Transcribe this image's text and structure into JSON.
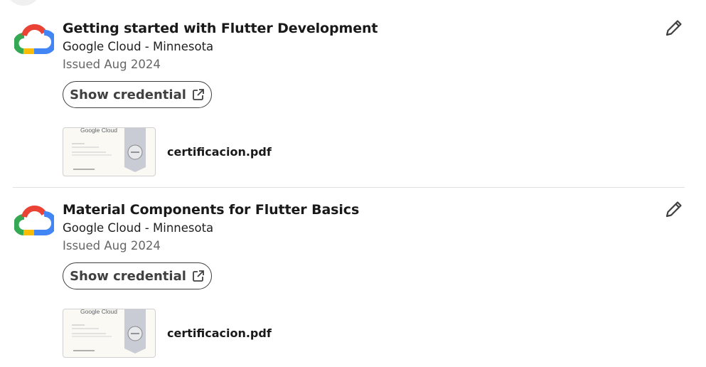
{
  "certifications": [
    {
      "title": "Getting started with Flutter Development",
      "issuer": "Google Cloud - Minnesota",
      "issued": "Issued Aug 2024",
      "show_credential_label": "Show credential",
      "media": {
        "thumbnail_logo_text": "Google Cloud",
        "file_name": "certificacion.pdf"
      }
    },
    {
      "title": "Material Components for Flutter Basics",
      "issuer": "Google Cloud - Minnesota",
      "issued": "Issued Aug 2024",
      "show_credential_label": "Show credential",
      "media": {
        "thumbnail_logo_text": "Google Cloud",
        "file_name": "certificacion.pdf"
      }
    }
  ],
  "icons": {
    "issuer_logo": "google-cloud-logo-icon",
    "external_link": "external-link-icon",
    "edit": "pencil-icon"
  },
  "colors": {
    "cloud_red": "#EA4335",
    "cloud_blue": "#4285F4",
    "cloud_yellow": "#FBBC04",
    "cloud_green": "#34A853",
    "button_border": "#404040",
    "divider": "#e0e0e0"
  }
}
